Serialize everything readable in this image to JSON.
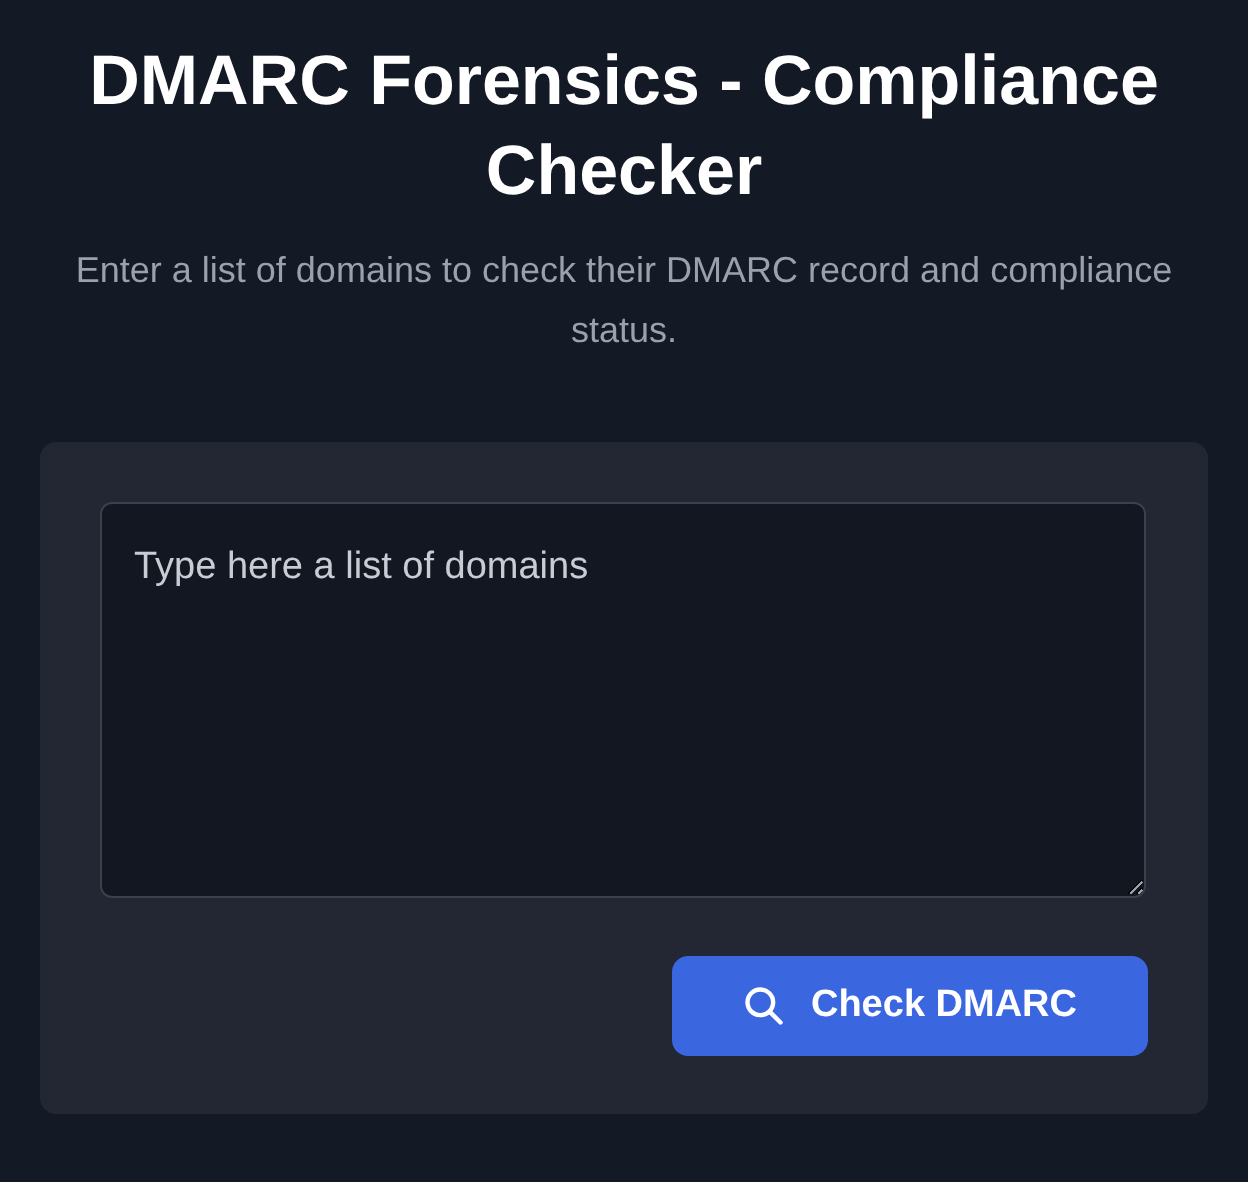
{
  "title": "DMARC Forensics - Compliance Checker",
  "subtitle": "Enter a list of domains to check their DMARC record and compliance status.",
  "domains_field": {
    "placeholder": "Type here a list of domains"
  },
  "check_button": {
    "label": "Check DMARC"
  }
}
